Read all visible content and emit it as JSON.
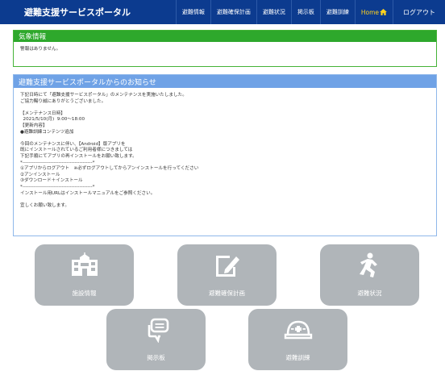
{
  "header": {
    "brand": "避難支援サービスポータル",
    "nav": [
      "避難情報",
      "避難確保計画",
      "避難状況",
      "掲示板",
      "避難訓練",
      "Home",
      "ログアウト"
    ]
  },
  "weather": {
    "title": "気象情報",
    "body": "警報はありません。"
  },
  "notice": {
    "title": "避難支援サービスポータルからのお知らせ",
    "lines": [
      "下記日時にて「避難支援サービスポータル」のメンテナンスを実施いたしました。",
      "ご協力賜り誠にありがとうございました。",
      "",
      "【メンテナンス日時】",
      "  2021/5/10(月)  9:00～18:00",
      "【更新内容】",
      "●避難訓練コンテンツ追加",
      "",
      "今回のメンテナンスに伴い、【Android】版アプリを",
      "既にインストールされているご利用者様につきましては",
      "下記手順にてアプリの再インストールをお願い致します。",
      "*-------------------------------------------*",
      "①アプリからログアウト　※必ずログアウトしてからアンインストールを行ってください",
      "②アンインストール",
      "③ダウンロード＋インストール",
      "*-------------------------------------------*",
      "インストール用URLはインストールマニュアルをご参照ください。",
      "",
      "宜しくお願い致します。"
    ]
  },
  "tiles": [
    {
      "label": "施設情報",
      "icon": "school-building-icon"
    },
    {
      "label": "避難確保計画",
      "icon": "document-pencil-icon"
    },
    {
      "label": "避難状況",
      "icon": "running-person-icon"
    },
    {
      "label": "掲示板",
      "icon": "speech-bubble-icon"
    },
    {
      "label": "避難訓練",
      "icon": "safety-helmet-icon"
    }
  ],
  "colors": {
    "header_bg": "#0c3b8f",
    "weather_head": "#2ea82c",
    "notice_head": "#6fa2e6",
    "tile_bg": "#b0b5b9",
    "home_accent": "#ffd21e"
  }
}
